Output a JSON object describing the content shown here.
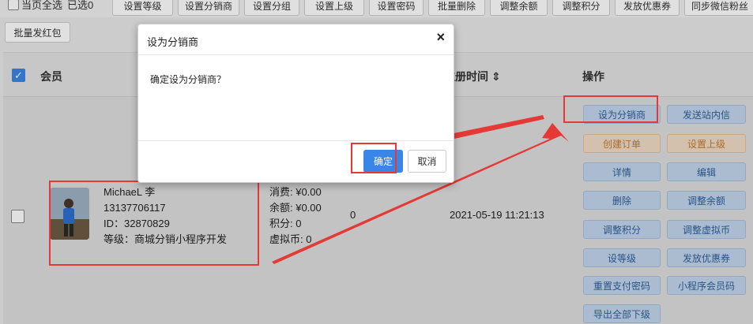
{
  "toolbar": {
    "select_all_label": "当页全选",
    "selected_label": "已选0",
    "buttons": [
      "设置等级",
      "设置分销商",
      "设置分组",
      "设置上级",
      "设置密码",
      "批量删除",
      "调整余额",
      "调整积分",
      "发放优惠券",
      "同步微信粉丝"
    ],
    "row2_button": "批量发红包"
  },
  "table": {
    "headers": {
      "member": "会员",
      "reg_time": "注册时间 ⇕",
      "actions": "操作"
    }
  },
  "member": {
    "name": "MichaeL 李",
    "phone": "13137706117",
    "id": "ID：32870829",
    "level": "等级：商城分销小程序开发"
  },
  "stats": {
    "consume": "消费: ¥0.00",
    "balance": "余额: ¥0.00",
    "points": "积分: 0",
    "virtual": "虚拟币: 0"
  },
  "zero_value": "0",
  "reg_time": "2021-05-19 11:21:13",
  "actions": {
    "left": [
      "设为分销商",
      "创建订单",
      "详情",
      "删除",
      "调整积分",
      "设等级",
      "重置支付密码",
      "导出全部下级"
    ],
    "right": [
      "发送站内信",
      "设置上级",
      "编辑",
      "调整余额",
      "调整虚拟币",
      "发放优惠券",
      "小程序会员码"
    ]
  },
  "modal": {
    "title": "设为分销商",
    "close": "×",
    "message": "确定设为分销商？",
    "ok": "确定",
    "cancel": "取消"
  },
  "colors": {
    "primary": "#3a86e8",
    "highlight": "#e53935",
    "action_blue_bg": "#c3d7ee",
    "action_orange_bg": "#f1dcc5"
  }
}
